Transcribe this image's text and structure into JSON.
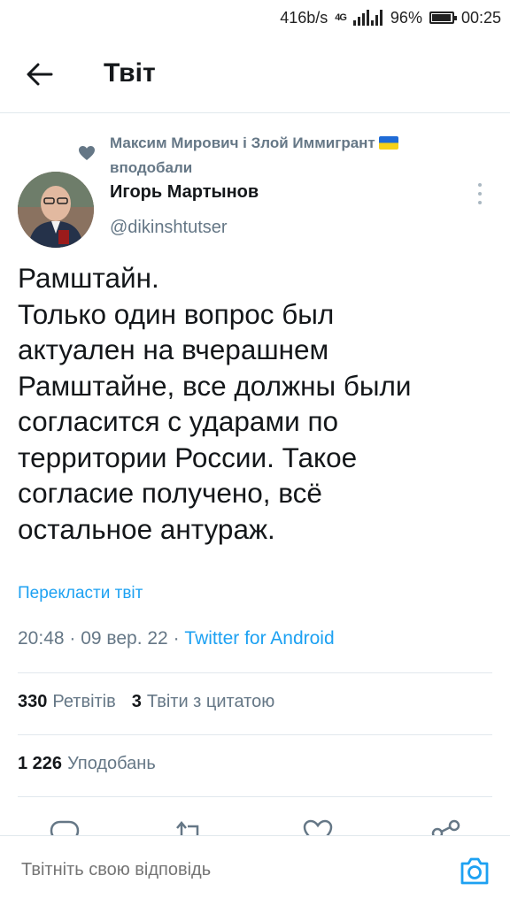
{
  "status_bar": {
    "net_speed": "416b/s",
    "network": "4G",
    "battery": "96%",
    "time": "00:25"
  },
  "header": {
    "title": "Твіт",
    "back_icon": "arrow-left-icon"
  },
  "social_context": {
    "text": "Максим Мирович і Злой Иммигрант",
    "liked_label": "вподобали",
    "icon": "heart-icon"
  },
  "author": {
    "name": "Игорь Мартынов",
    "handle": "@dikinshtutser"
  },
  "tweet": {
    "lines": [
      "Рамштайн.",
      "Только один вопрос был",
      "актуален на вчерашнем",
      "Рамштайне, все должны были",
      "согласится с ударами по",
      "территории России. Такое",
      "согласие получено, всё",
      "остальное антураж."
    ],
    "translate_label": "Перекласти твіт",
    "time": "20:48",
    "date": "09 вер. 22",
    "source": "Twitter for Android"
  },
  "stats": {
    "retweets_count": "330",
    "retweets_label": "Ретвітів",
    "quotes_count": "3",
    "quotes_label": "Твіти з цитатою",
    "likes_count": "1 226",
    "likes_label": "Уподобань"
  },
  "reply": {
    "placeholder": "Твітніть свою відповідь"
  },
  "colors": {
    "accent": "#1da1f2",
    "muted": "#657786",
    "text": "#14171a"
  }
}
